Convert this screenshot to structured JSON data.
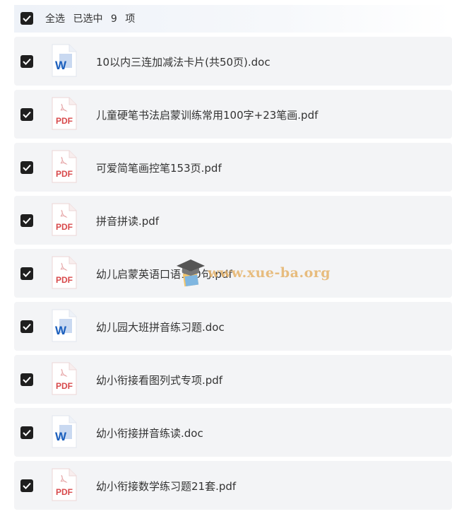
{
  "header": {
    "select_all": "全选",
    "selected_prefix": "已选中",
    "selected_count": "9",
    "selected_suffix": "项"
  },
  "files": [
    {
      "name": "10以内三连加减法卡片(共50页).doc",
      "type": "word"
    },
    {
      "name": "儿童硬笔书法启蒙训练常用100字+23笔画.pdf",
      "type": "pdf"
    },
    {
      "name": "可爱简笔画控笔153页.pdf",
      "type": "pdf"
    },
    {
      "name": "拼音拼读.pdf",
      "type": "pdf"
    },
    {
      "name": "幼儿启蒙英语口语100句.pdf",
      "type": "pdf"
    },
    {
      "name": "幼儿园大班拼音练习题.doc",
      "type": "word"
    },
    {
      "name": "幼小衔接看图列式专项.pdf",
      "type": "pdf"
    },
    {
      "name": "幼小衔接拼音练读.doc",
      "type": "word"
    },
    {
      "name": "幼小衔接数学练习题21套.pdf",
      "type": "pdf"
    }
  ],
  "icons": {
    "word_label": "W",
    "pdf_label": "PDF",
    "word_color": "#1b5fbd",
    "pdf_color": "#d8494b"
  },
  "watermark": {
    "text": "www.xue-ba.org"
  }
}
